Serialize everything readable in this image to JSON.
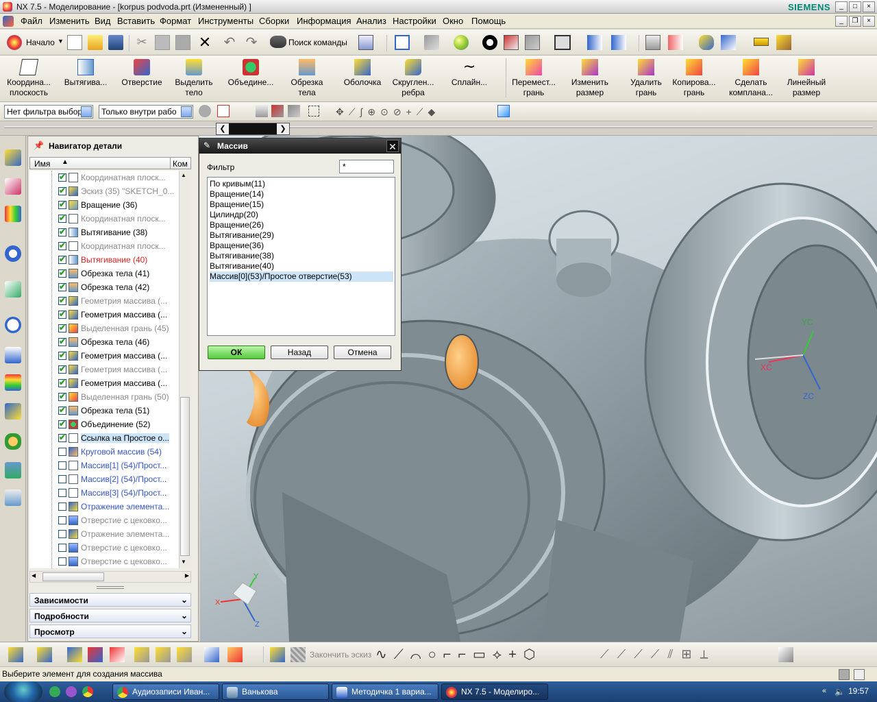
{
  "window": {
    "title": "NX 7.5 - Моделирование - [korpus podvoda.prt (Измененный) ]",
    "brand": "SIEMENS"
  },
  "menu": [
    "Файл",
    "Изменить",
    "Вид",
    "Вставить",
    "Формат",
    "Инструменты",
    "Сборки",
    "Информация",
    "Анализ",
    "Настройки",
    "Окно",
    "Помощь"
  ],
  "toolbar": {
    "start_label": "Начало",
    "search_label": "Поиск команды"
  },
  "ribbon": [
    {
      "label": "Координа... плоскость"
    },
    {
      "label": "Вытягива..."
    },
    {
      "label": "Отверстие"
    },
    {
      "label": "Выделить тело"
    },
    {
      "label": "Объедине..."
    },
    {
      "label": "Обрезка тела"
    },
    {
      "label": "Оболочка"
    },
    {
      "label": "Скруглен... ребра"
    },
    {
      "label": "Сплайн..."
    },
    {
      "label": "Перемест... грань"
    },
    {
      "label": "Изменить размер"
    },
    {
      "label": "Удалить грань"
    },
    {
      "label": "Копирова... грань"
    },
    {
      "label": "Сделать компланa..."
    },
    {
      "label": "Линейный размер"
    }
  ],
  "selection_bar": {
    "type_filter": "Нет фильтра выбор",
    "scope": "Только внутри рабо"
  },
  "navigator": {
    "title": "Навигатор детали",
    "columns": {
      "name": "Имя",
      "comment": "Ком"
    },
    "rows": [
      {
        "label": "Координатная плоск...",
        "checked": true,
        "style": "gray",
        "icon": "datum-plane-icon"
      },
      {
        "label": "Эскиз (35) \"SKETCH_0...",
        "checked": true,
        "style": "gray",
        "icon": "sketch-icon"
      },
      {
        "label": "Вращение (36)",
        "checked": true,
        "style": "normal",
        "icon": "revolve-icon"
      },
      {
        "label": "Координатная плоск...",
        "checked": true,
        "style": "gray",
        "icon": "datum-plane-icon"
      },
      {
        "label": "Вытягивание (38)",
        "checked": true,
        "style": "normal",
        "icon": "extrude-icon"
      },
      {
        "label": "Координатная плоск...",
        "checked": true,
        "style": "gray",
        "icon": "datum-plane-icon"
      },
      {
        "label": "Вытягивание (40)",
        "checked": true,
        "style": "red",
        "icon": "extrude-icon"
      },
      {
        "label": "Обрезка тела (41)",
        "checked": true,
        "style": "normal",
        "icon": "trim-body-icon"
      },
      {
        "label": "Обрезка тела (42)",
        "checked": true,
        "style": "normal",
        "icon": "trim-body-icon"
      },
      {
        "label": "Геометрия массива (...",
        "checked": true,
        "style": "gray",
        "icon": "pattern-geometry-icon"
      },
      {
        "label": "Геометрия массива (...",
        "checked": true,
        "style": "normal",
        "icon": "pattern-geometry-icon"
      },
      {
        "label": "Выделенная грань (45)",
        "checked": true,
        "style": "gray",
        "icon": "extract-face-icon"
      },
      {
        "label": "Обрезка тела (46)",
        "checked": true,
        "style": "normal",
        "icon": "trim-body-icon"
      },
      {
        "label": "Геометрия массива (...",
        "checked": true,
        "style": "normal",
        "icon": "pattern-geometry-icon"
      },
      {
        "label": "Геометрия массива (...",
        "checked": true,
        "style": "gray",
        "icon": "pattern-geometry-icon"
      },
      {
        "label": "Геометрия массива (...",
        "checked": true,
        "style": "normal",
        "icon": "pattern-geometry-icon"
      },
      {
        "label": "Выделенная грань (50)",
        "checked": true,
        "style": "gray",
        "icon": "extract-face-icon"
      },
      {
        "label": "Обрезка тела (51)",
        "checked": true,
        "style": "normal",
        "icon": "trim-body-icon"
      },
      {
        "label": "Объединение (52)",
        "checked": true,
        "style": "normal",
        "icon": "unite-icon"
      },
      {
        "label": "Ссылка на Простое о...",
        "checked": true,
        "style": "selected",
        "icon": "hole-icon"
      },
      {
        "label": "Круговой массив (54)",
        "checked": false,
        "style": "blue",
        "icon": "circular-array-icon"
      },
      {
        "label": "Массив[1] (54)/Прост...",
        "checked": false,
        "style": "blue",
        "icon": "hole-icon"
      },
      {
        "label": "Массив[2] (54)/Прост...",
        "checked": false,
        "style": "blue",
        "icon": "hole-icon"
      },
      {
        "label": "Массив[3] (54)/Прост...",
        "checked": false,
        "style": "blue",
        "icon": "hole-icon"
      },
      {
        "label": "Отражение элемента...",
        "checked": false,
        "style": "blue",
        "icon": "mirror-icon"
      },
      {
        "label": "Отверстие с цековко...",
        "checked": false,
        "style": "gray",
        "icon": "counterbore-hole-icon"
      },
      {
        "label": "Отражение элемента...",
        "checked": false,
        "style": "gray",
        "icon": "mirror-icon"
      },
      {
        "label": "Отверстие с цековко...",
        "checked": false,
        "style": "gray",
        "icon": "counterbore-hole-icon"
      },
      {
        "label": "Отверстие с цековко...",
        "checked": false,
        "style": "gray",
        "icon": "counterbore-hole-icon"
      }
    ],
    "panels": [
      "Зависимости",
      "Подробности",
      "Просмотр"
    ]
  },
  "dialog": {
    "title": "Массив",
    "filter_label": "Фильтр",
    "filter_value": "*",
    "items": [
      "По кривым(11)",
      "Вращение(14)",
      "Вращение(15)",
      "Цилиндр(20)",
      "Вращение(26)",
      "Вытягивание(29)",
      "Вращение(36)",
      "Вытягивание(38)",
      "Вытягивание(40)",
      "Массив[0](53)/Простое отверстие(53)"
    ],
    "selected_index": 9,
    "buttons": {
      "ok": "ОК",
      "back": "Назад",
      "cancel": "Отмена"
    }
  },
  "triad": {
    "x": "X",
    "y": "Y",
    "z": "Z",
    "xc": "XC",
    "yc": "YC",
    "zc": "ZC"
  },
  "bottom_toolbar": {
    "finish_sketch": "Закончить эскиз"
  },
  "status_text": "Выберите элемент для создания массива",
  "taskbar": {
    "buttons": [
      "Аудиозаписи Иван...",
      "Ванькова",
      "Методичка 1 вариа...",
      "NX 7.5 - Моделиро..."
    ],
    "clock": "19:57"
  },
  "colors": {
    "accent_orange": "#f5a04a",
    "selection": "#cde4f7",
    "ok_green": "#57c93c"
  }
}
